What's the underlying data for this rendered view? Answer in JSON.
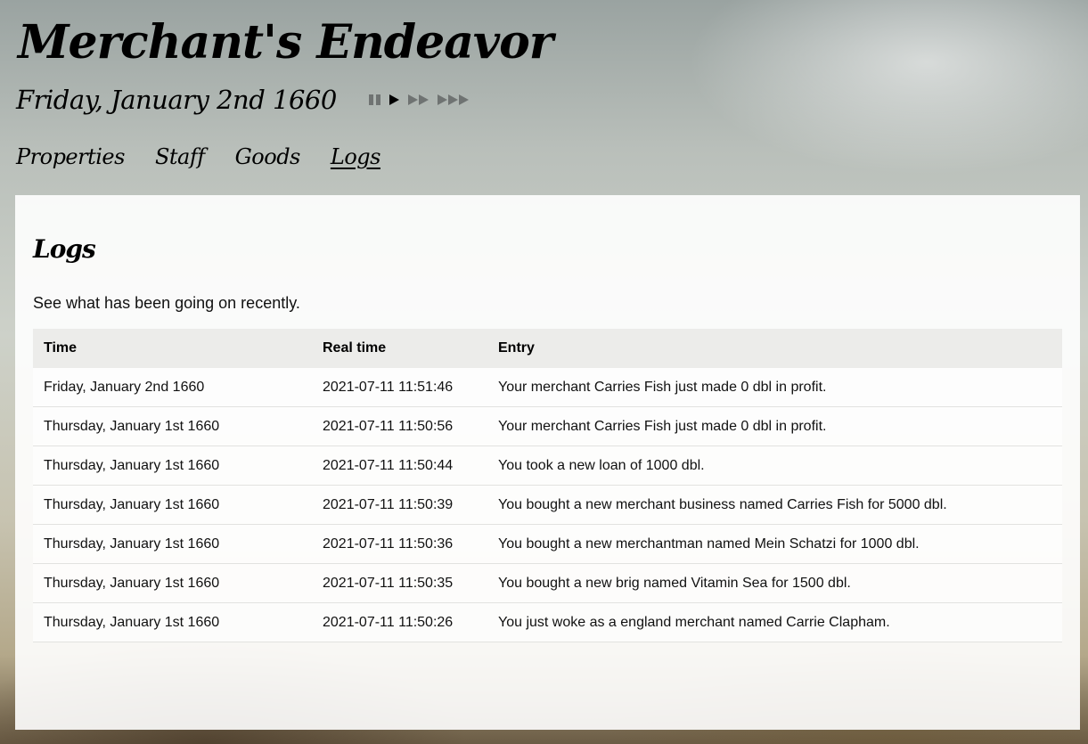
{
  "app": {
    "title": "Merchant's Endeavor",
    "date": "Friday, January 2nd 1660"
  },
  "speed_controls": [
    {
      "name": "pause",
      "icon": "pause-icon",
      "active": false
    },
    {
      "name": "play",
      "icon": "play-icon",
      "active": true
    },
    {
      "name": "fast",
      "icon": "fast-forward-icon",
      "active": false
    },
    {
      "name": "fastest",
      "icon": "fastest-forward-icon",
      "active": false
    }
  ],
  "nav": {
    "items": [
      {
        "label": "Properties",
        "active": false
      },
      {
        "label": "Staff",
        "active": false
      },
      {
        "label": "Goods",
        "active": false
      },
      {
        "label": "Logs",
        "active": true
      }
    ]
  },
  "page": {
    "heading": "Logs",
    "subtitle": "See what has been going on recently."
  },
  "table": {
    "headers": [
      "Time",
      "Real time",
      "Entry"
    ],
    "rows": [
      [
        "Friday, January 2nd 1660",
        "2021-07-11 11:51:46",
        "Your merchant Carries Fish just made 0 dbl in profit."
      ],
      [
        "Thursday, January 1st 1660",
        "2021-07-11 11:50:56",
        "Your merchant Carries Fish just made 0 dbl in profit."
      ],
      [
        "Thursday, January 1st 1660",
        "2021-07-11 11:50:44",
        "You took a new loan of 1000 dbl."
      ],
      [
        "Thursday, January 1st 1660",
        "2021-07-11 11:50:39",
        "You bought a new merchant business named Carries Fish for 5000 dbl."
      ],
      [
        "Thursday, January 1st 1660",
        "2021-07-11 11:50:36",
        "You bought a new merchantman named Mein Schatzi for 1000 dbl."
      ],
      [
        "Thursday, January 1st 1660",
        "2021-07-11 11:50:35",
        "You bought a new brig named Vitamin Sea for 1500 dbl."
      ],
      [
        "Thursday, January 1st 1660",
        "2021-07-11 11:50:26",
        "You just woke as a england merchant named Carrie Clapham."
      ]
    ]
  }
}
